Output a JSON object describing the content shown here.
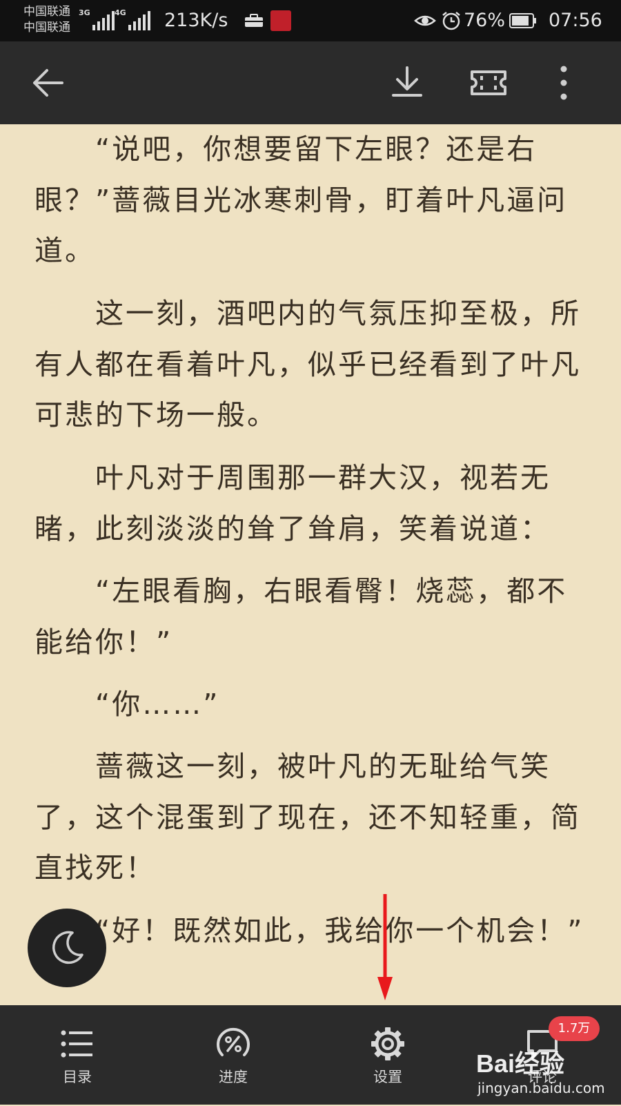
{
  "status_bar": {
    "carrier_1": "中国联通",
    "carrier_2": "中国联通",
    "net_1": "3G",
    "net_2": "4G",
    "speed": "213K/s",
    "battery": "76%",
    "time": "07:56"
  },
  "toolbar": {
    "icons": [
      "back-arrow-icon",
      "download-icon",
      "ticket-icon",
      "more-vertical-icon"
    ]
  },
  "content": {
    "paragraphs": [
      "“说吧，你想要留下左眼？还是右眼？”蔷薇目光冰寒刺骨，盯着叶凡逼问道。",
      "这一刻，酒吧内的气氛压抑至极，所有人都在看着叶凡，似乎已经看到了叶凡可悲的下场一般。",
      "叶凡对于周围那一群大汉，视若无睹，此刻淡淡的耸了耸肩，笑着说道：",
      "“左眼看胸，右眼看臀！烧蕊，都不能给你！”",
      "“你……”",
      "蔷薇这一刻，被叶凡的无耻给气笑了，这个混蛋到了现在，还不知轻重，简直找死！",
      "“好！既然如此，我给你一个机会！”"
    ]
  },
  "bottom_bar": {
    "items": [
      {
        "label": "目录",
        "icon": "list-icon"
      },
      {
        "label": "进度",
        "icon": "progress-icon"
      },
      {
        "label": "设置",
        "icon": "settings-gear-icon"
      },
      {
        "label": "评论",
        "icon": "comment-icon"
      }
    ],
    "comment_badge": "1.7万"
  },
  "watermark": {
    "brand": "Bai经验",
    "url": "jingyan.baidu.com"
  },
  "colors": {
    "page_background": "#efe2c3",
    "bar_background": "#2b2b2b",
    "text": "#3a3024",
    "badge": "#e8434a",
    "annotation_arrow": "#e8191c"
  }
}
